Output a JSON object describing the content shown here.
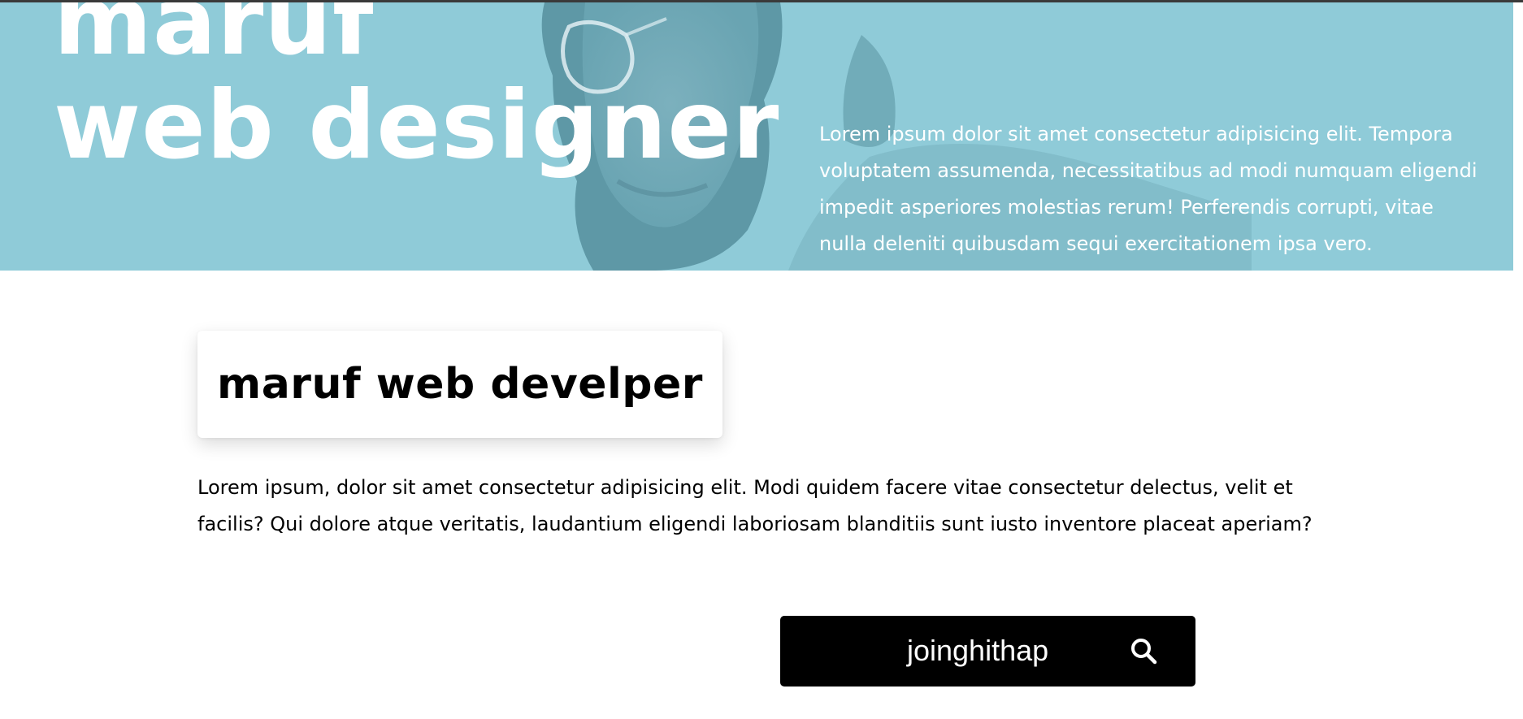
{
  "hero": {
    "title_line1": "maruf",
    "title_line2": "web designer",
    "description": "Lorem ipsum dolor sit amet consectetur adipisicing elit. Tempora voluptatem assumenda, necessitatibus ad modi numquam eligendi impedit asperiores molestias rerum! Perferendis corrupti, vitae nulla deleniti quibusdam sequi exercitationem ipsa vero.",
    "overlay_color": "#8fcbd8"
  },
  "content": {
    "card_title": "maruf web develper",
    "paragraph": "Lorem ipsum, dolor sit amet consectetur adipisicing elit. Modi quidem facere vitae consectetur delectus, velit et facilis? Qui dolore atque veritatis, laudantium eligendi laboriosam blanditiis sunt iusto inventore placeat aperiam?"
  },
  "cta": {
    "label": "joinghithap",
    "icon": "search-icon",
    "background": "#000000"
  }
}
